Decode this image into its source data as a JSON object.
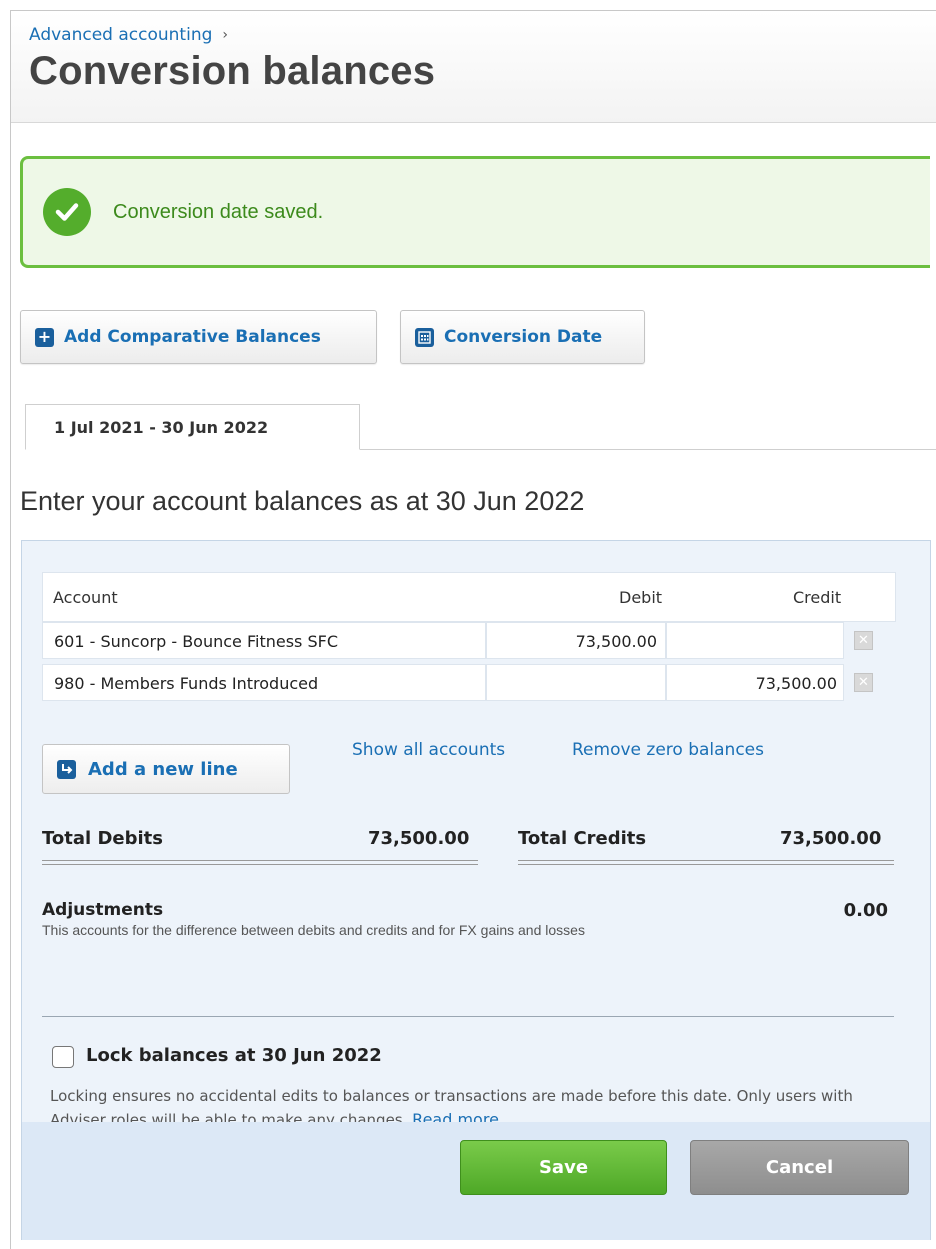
{
  "header": {
    "breadcrumb": "Advanced accounting",
    "breadcrumb_chevron": "›",
    "title": "Conversion balances"
  },
  "alert": {
    "message": "Conversion date saved.",
    "icon": "check-circle-icon",
    "color": "#54ad2c"
  },
  "toolbar": {
    "add_comparative_label": "Add Comparative Balances",
    "conversion_date_label": "Conversion Date"
  },
  "tabs": [
    {
      "label": "1 Jul 2021 - 30 Jun 2022",
      "active": true
    }
  ],
  "section": {
    "title": "Enter your account balances as at 30 Jun 2022"
  },
  "table": {
    "columns": {
      "account": "Account",
      "debit": "Debit",
      "credit": "Credit"
    },
    "rows": [
      {
        "account": "601 - Suncorp - Bounce Fitness SFC",
        "debit": "73,500.00",
        "credit": ""
      },
      {
        "account": "980 - Members Funds Introduced",
        "debit": "",
        "credit": "73,500.00"
      }
    ]
  },
  "actions": {
    "add_line_label": "Add a new line",
    "show_all_label": "Show all accounts",
    "remove_zero_label": "Remove zero balances"
  },
  "totals": {
    "debits_label": "Total Debits",
    "debits_value": "73,500.00",
    "credits_label": "Total Credits",
    "credits_value": "73,500.00"
  },
  "adjustments": {
    "label": "Adjustments",
    "description": "This accounts for the difference between debits and credits and for FX gains and losses",
    "value": "0.00"
  },
  "lock": {
    "label": "Lock balances at 30 Jun 2022",
    "checked": false,
    "description": "Locking ensures no accidental edits to balances or transactions are made before this date. Only users with Adviser roles will be able to make any changes.",
    "read_more": "Read more"
  },
  "footer": {
    "save_label": "Save",
    "cancel_label": "Cancel",
    "save_color": "#54ad2c",
    "cancel_color": "#9a9a9a"
  }
}
